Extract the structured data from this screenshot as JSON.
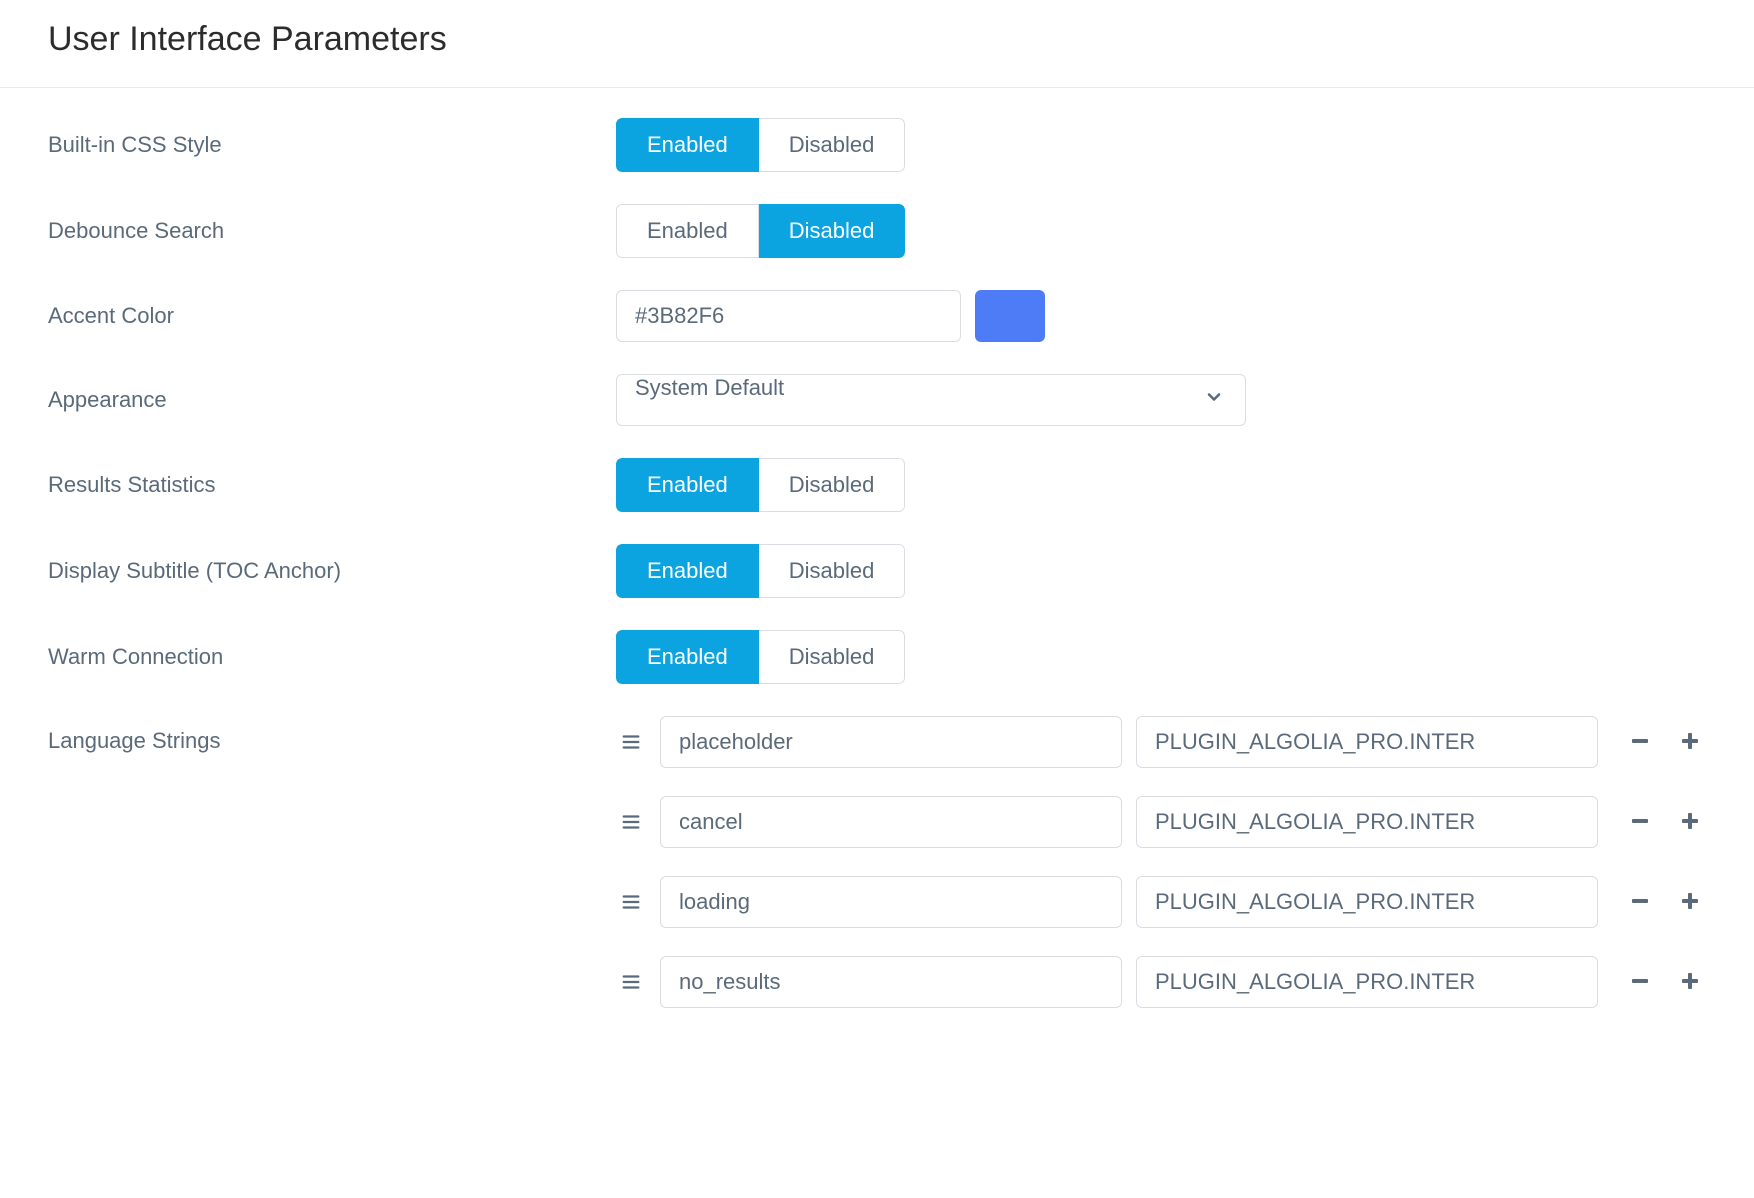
{
  "page": {
    "title": "User Interface Parameters"
  },
  "labels": {
    "enabled": "Enabled",
    "disabled": "Disabled"
  },
  "fields": {
    "css_style": {
      "label": "Built-in CSS Style",
      "value": "enabled"
    },
    "debounce": {
      "label": "Debounce Search",
      "value": "disabled"
    },
    "accent": {
      "label": "Accent Color",
      "value": "#3B82F6",
      "swatch": "#4e7cf6"
    },
    "appearance": {
      "label": "Appearance",
      "value": "System Default"
    },
    "results_stats": {
      "label": "Results Statistics",
      "value": "enabled"
    },
    "display_subtitle": {
      "label": "Display Subtitle (TOC Anchor)",
      "value": "enabled"
    },
    "warm_connection": {
      "label": "Warm Connection",
      "value": "enabled"
    },
    "language_strings": {
      "label": "Language Strings",
      "items": [
        {
          "key": "placeholder",
          "value": "PLUGIN_ALGOLIA_PRO.INTER"
        },
        {
          "key": "cancel",
          "value": "PLUGIN_ALGOLIA_PRO.INTER"
        },
        {
          "key": "loading",
          "value": "PLUGIN_ALGOLIA_PRO.INTER"
        },
        {
          "key": "no_results",
          "value": "PLUGIN_ALGOLIA_PRO.INTER"
        }
      ]
    }
  }
}
